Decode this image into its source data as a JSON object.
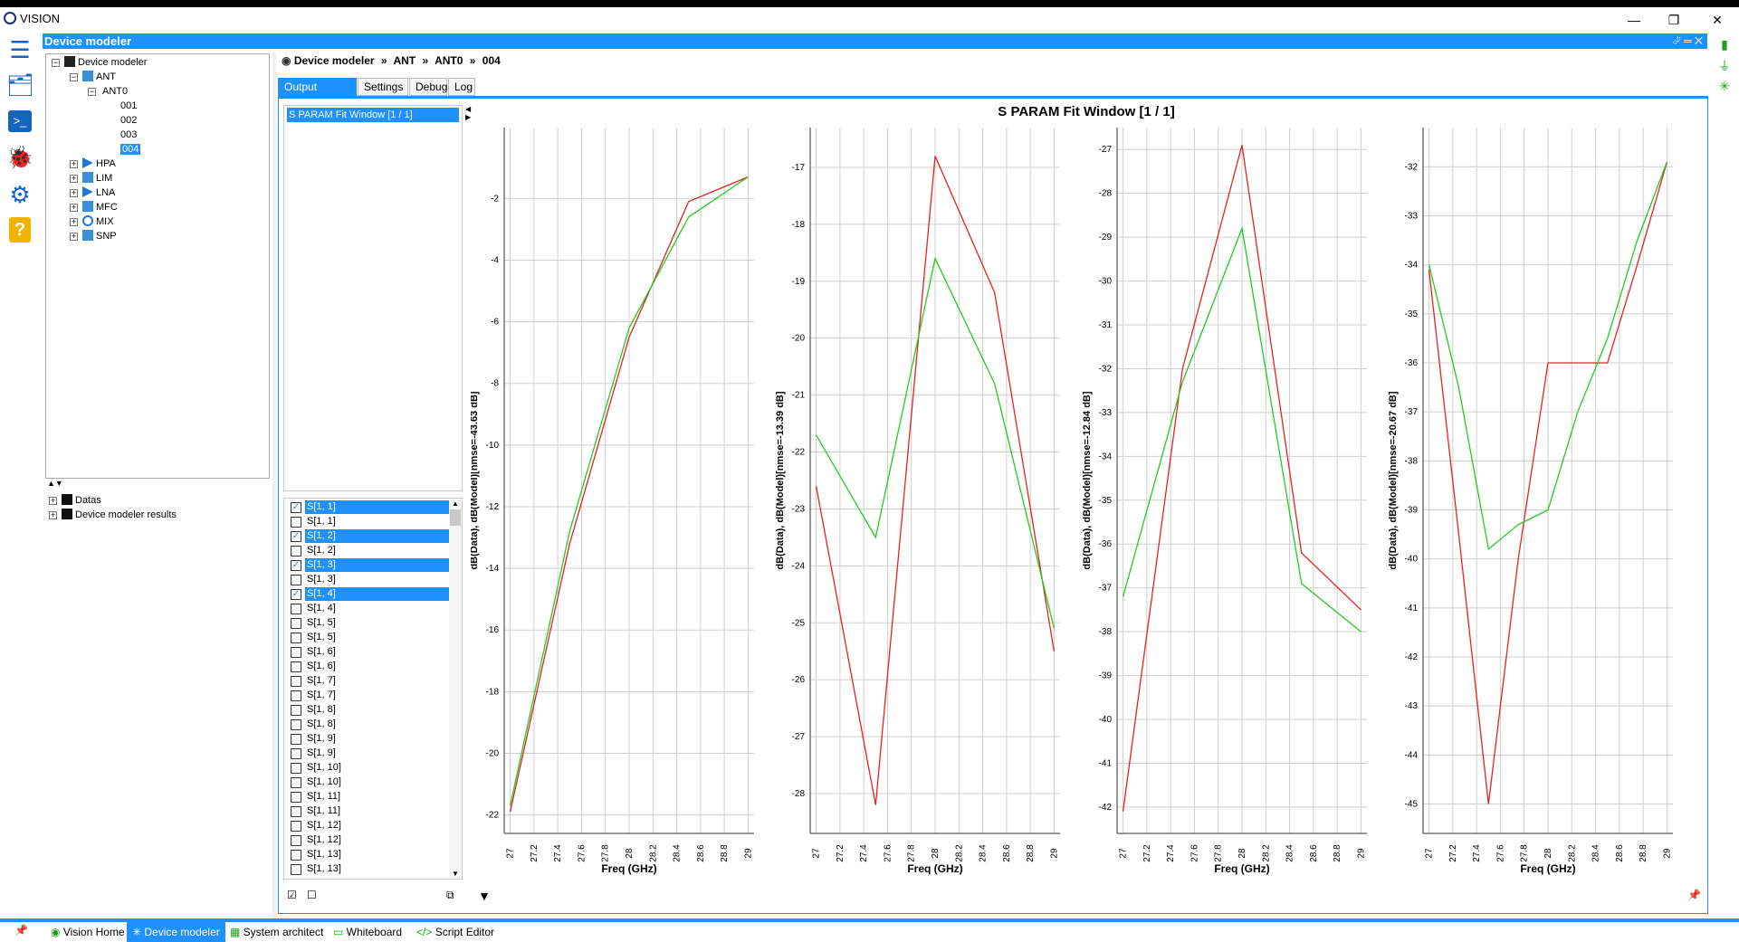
{
  "app": {
    "title": "VISION"
  },
  "panel": {
    "title": "Device modeler",
    "controls": "⮰ ═ ✕"
  },
  "tree": {
    "root": "Device modeler",
    "nodes": [
      "ANT",
      "ANT0",
      "001",
      "002",
      "003",
      "004",
      "HPA",
      "LIM",
      "LNA",
      "MFC",
      "MIX",
      "SNP"
    ],
    "bottom": [
      "Datas",
      "Device modeler results"
    ]
  },
  "breadcrumb": {
    "root": "Device modeler",
    "sep": "»",
    "p1": "ANT",
    "p2": "ANT0",
    "p3": "004"
  },
  "tabs": [
    "Output graphs",
    "Settings",
    "Debug",
    "Log"
  ],
  "winlist": {
    "item": "S PARAM Fit Window [1 / 1]"
  },
  "signals": [
    {
      "label": "S[1, 1]",
      "checked": true
    },
    {
      "label": "S[1, 1]",
      "checked": false
    },
    {
      "label": "S[1, 2]",
      "checked": true
    },
    {
      "label": "S[1, 2]",
      "checked": false
    },
    {
      "label": "S[1, 3]",
      "checked": true
    },
    {
      "label": "S[1, 3]",
      "checked": false
    },
    {
      "label": "S[1, 4]",
      "checked": true
    },
    {
      "label": "S[1, 4]",
      "checked": false
    },
    {
      "label": "S[1, 5]",
      "checked": false
    },
    {
      "label": "S[1, 5]",
      "checked": false
    },
    {
      "label": "S[1, 6]",
      "checked": false
    },
    {
      "label": "S[1, 6]",
      "checked": false
    },
    {
      "label": "S[1, 7]",
      "checked": false
    },
    {
      "label": "S[1, 7]",
      "checked": false
    },
    {
      "label": "S[1, 8]",
      "checked": false
    },
    {
      "label": "S[1, 8]",
      "checked": false
    },
    {
      "label": "S[1, 9]",
      "checked": false
    },
    {
      "label": "S[1, 9]",
      "checked": false
    },
    {
      "label": "S[1, 10]",
      "checked": false
    },
    {
      "label": "S[1, 10]",
      "checked": false
    },
    {
      "label": "S[1, 11]",
      "checked": false
    },
    {
      "label": "S[1, 11]",
      "checked": false
    },
    {
      "label": "S[1, 12]",
      "checked": false
    },
    {
      "label": "S[1, 12]",
      "checked": false
    },
    {
      "label": "S[1, 13]",
      "checked": false
    },
    {
      "label": "S[1, 13]",
      "checked": false
    }
  ],
  "statusbar": {
    "tabs": [
      "Vision Home",
      "Device modeler",
      "System architect",
      "Whiteboard",
      "Script Editor"
    ],
    "active": "Device modeler"
  },
  "colors": {
    "accent": "#1e90ff",
    "data": "#e82020",
    "model": "#22cc22"
  },
  "chart_data": {
    "window_title": "S PARAM Fit Window [1 / 1]",
    "charts": [
      {
        "type": "line",
        "xlabel": "Freq (GHz)",
        "ylabel": "dB(Data),  dB(Model)[nmse=-43.63 dB]",
        "ylim": [
          -22.6,
          0.3
        ],
        "yticks": [
          -2,
          -4,
          -6,
          -8,
          -10,
          -12,
          -14,
          -16,
          -18,
          -20,
          -22
        ],
        "x": [
          27,
          27.5,
          28,
          28.5,
          29
        ],
        "series": [
          {
            "values": [
              -21.9,
              -13.2,
              -6.5,
              -2.1,
              -1.3
            ]
          },
          {
            "values": [
              -21.7,
              -12.8,
              -6.2,
              -2.6,
              -1.3
            ]
          }
        ]
      },
      {
        "type": "line",
        "xlabel": "Freq (GHz)",
        "ylabel": "dB(Data),  dB(Model)[nmse=-13.39 dB]",
        "ylim": [
          -28.7,
          -16.3
        ],
        "yticks": [
          -17,
          -18,
          -19,
          -20,
          -21,
          -22,
          -23,
          -24,
          -25,
          -26,
          -27,
          -28
        ],
        "x": [
          27,
          27.5,
          28,
          28.5,
          29
        ],
        "series": [
          {
            "values": [
              -22.6,
              -28.2,
              -16.8,
              -19.2,
              -25.5
            ]
          },
          {
            "values": [
              -21.7,
              -23.5,
              -18.6,
              -20.8,
              -25.1
            ]
          }
        ]
      },
      {
        "type": "line",
        "xlabel": "Freq (GHz)",
        "ylabel": "dB(Data),  dB(Model)[nmse=-12.84 dB]",
        "ylim": [
          -42.6,
          -26.5
        ],
        "yticks": [
          -27,
          -28,
          -29,
          -30,
          -31,
          -32,
          -33,
          -34,
          -35,
          -36,
          -37,
          -38,
          -39,
          -40,
          -41,
          -42
        ],
        "x": [
          27,
          27.5,
          28,
          28.5,
          29
        ],
        "series": [
          {
            "values": [
              -42.1,
              -32.0,
              -26.9,
              -36.2,
              -37.5
            ]
          },
          {
            "values": [
              -37.2,
              -32.3,
              -28.8,
              -36.9,
              -38.0
            ]
          }
        ]
      },
      {
        "type": "line",
        "xlabel": "Freq (GHz)",
        "ylabel": "dB(Data),  dB(Model)[nmse=-20.67 dB]",
        "ylim": [
          -45.6,
          -31.2
        ],
        "yticks": [
          -32,
          -33,
          -34,
          -35,
          -36,
          -37,
          -38,
          -39,
          -40,
          -41,
          -42,
          -43,
          -44,
          -45
        ],
        "x": [
          27,
          27.25,
          27.5,
          27.75,
          28,
          28.25,
          28.5,
          28.75,
          29
        ],
        "series": [
          {
            "values": [
              -34.1,
              -39.5,
              -45.0,
              -40.0,
              -36.0,
              -36.0,
              -36.0,
              -34.0,
              -31.9
            ]
          },
          {
            "values": [
              -34.0,
              -36.5,
              -39.8,
              -39.3,
              -39.0,
              -37.0,
              -35.5,
              -33.5,
              -31.9
            ]
          }
        ]
      }
    ],
    "xticks": [
      "27",
      "27.2",
      "27.4",
      "27.6",
      "27.8",
      "28",
      "28.2",
      "28.4",
      "28.6",
      "28.8",
      "29"
    ]
  }
}
